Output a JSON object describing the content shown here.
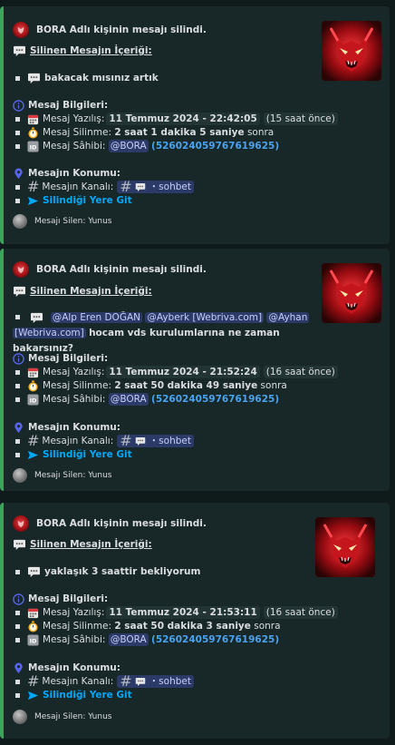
{
  "colors": {
    "background": "#0f1a1a",
    "embed_bg": "#182727",
    "accent_bar": "#3ba55c",
    "link": "#00a8fc",
    "mention_bg": "#2b3a66"
  },
  "labels": {
    "deleted_content": "Silinen Mesajın İçeriği:",
    "message_info": "Mesaj Bilgileri:",
    "written": "Mesaj Yazılış:",
    "deletion": "Mesaj Silinme:",
    "owner": "Mesaj Sâhibi:",
    "location": "Mesajın Konumu:",
    "channel": "Mesajın Kanalı:",
    "go_link": "Silindiği Yere Git"
  },
  "embeds": [
    {
      "author": "BORA Adlı kişinin mesajı silindi.",
      "content": "bakacak mısınız artık",
      "written_date": "11 Temmuz 2024 - 22:42:05",
      "written_ago": "15 saat önce",
      "deleted_after": "2 saat 1 dakika 5 saniye",
      "deleted_suffix": "sonra",
      "owner_mention": "@BORA",
      "owner_id": "(526024059767619625)",
      "channel_name": "sohbet",
      "footer": "Mesajı Silen: Yunus"
    },
    {
      "author": "BORA Adlı kişinin mesajı silindi.",
      "mention_1": "@Alp Eren DOĞAN",
      "mention_2": "@Ayberk [Webriva.com]",
      "mention_3a": "@Ayhan",
      "mention_3b": "[Webriva.com]",
      "content": "hocam vds kurulumlarına ne zaman bakarsınız?",
      "written_date": "11 Temmuz 2024 - 21:52:24",
      "written_ago": "16 saat önce",
      "deleted_after": "2 saat 50 dakika 49 saniye",
      "deleted_suffix": "sonra",
      "owner_mention": "@BORA",
      "owner_id": "(526024059767619625)",
      "channel_name": "sohbet",
      "footer": "Mesajı Silen: Yunus"
    },
    {
      "author": "BORA Adlı kişinin mesajı silindi.",
      "content": "yaklaşık 3 saattir bekliyorum",
      "written_date": "11 Temmuz 2024 - 21:53:11",
      "written_ago": "16 saat önce",
      "deleted_after": "2 saat 50 dakika 3 saniye",
      "deleted_suffix": "sonra",
      "owner_mention": "@BORA",
      "owner_id": "(526024059767619625)",
      "channel_name": "sohbet",
      "footer": "Mesajı Silen: Yunus"
    }
  ]
}
